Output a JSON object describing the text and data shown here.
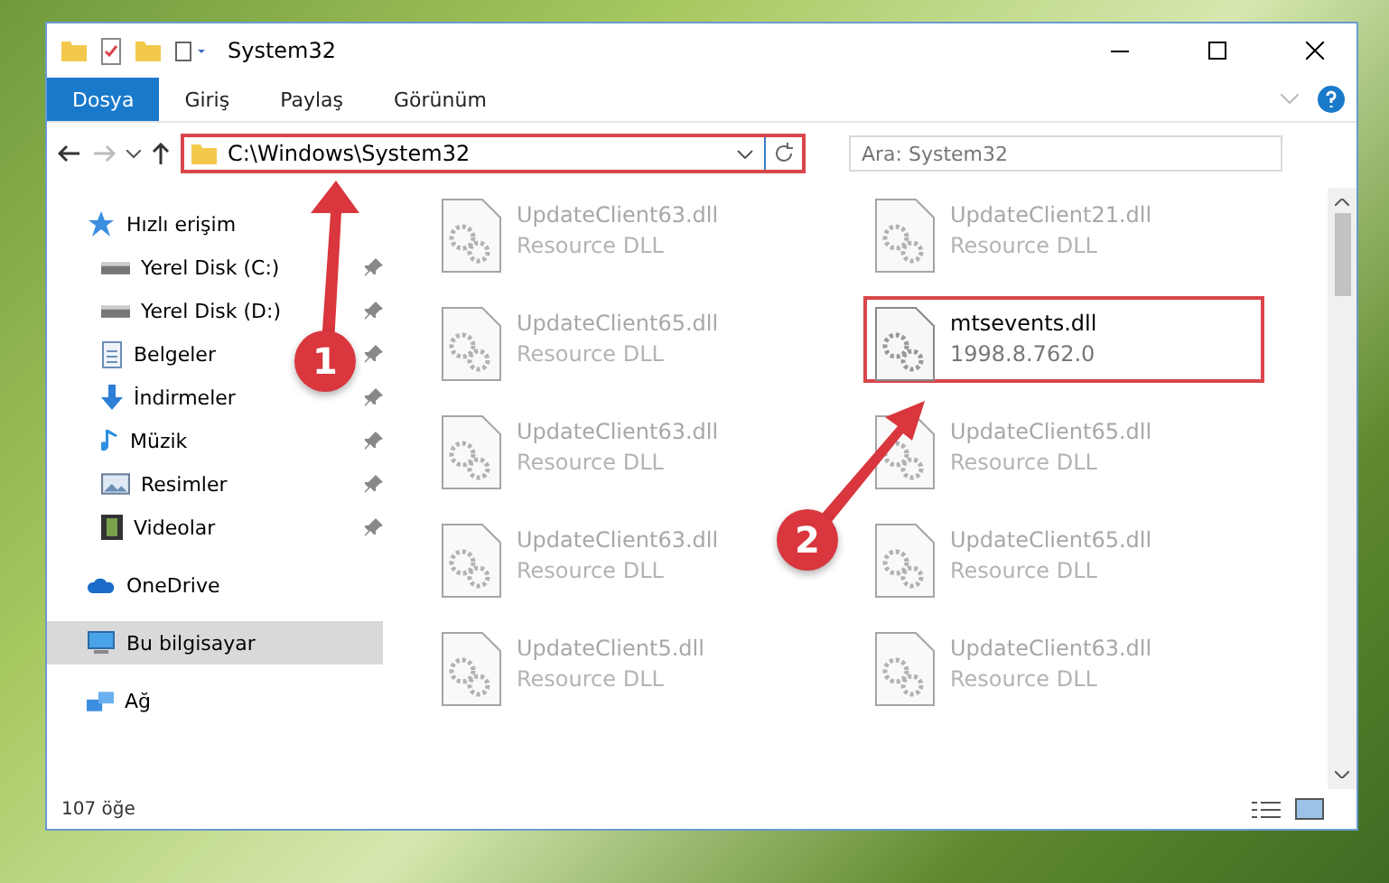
{
  "window": {
    "title": "System32"
  },
  "ribbon_tabs": [
    {
      "label": "Dosya",
      "selected": true
    },
    {
      "label": "Giriş",
      "selected": false
    },
    {
      "label": "Paylaş",
      "selected": false
    },
    {
      "label": "Görünüm",
      "selected": false
    }
  ],
  "address_bar": {
    "path": "C:\\Windows\\System32",
    "highlighted": true
  },
  "search": {
    "placeholder": "Ara: System32"
  },
  "sidebar": {
    "items": [
      {
        "label": "Hızlı erişim",
        "kind": "star",
        "selected": false,
        "children": [
          {
            "label": "Yerel Disk (C:)",
            "kind": "drive",
            "pinned": true
          },
          {
            "label": "Yerel Disk (D:)",
            "kind": "drive",
            "pinned": true
          },
          {
            "label": "Belgeler",
            "kind": "document",
            "pinned": true
          },
          {
            "label": "İndirmeler",
            "kind": "download",
            "pinned": true
          },
          {
            "label": "Müzik",
            "kind": "music",
            "pinned": true
          },
          {
            "label": "Resimler",
            "kind": "picture",
            "pinned": true
          },
          {
            "label": "Videolar",
            "kind": "video",
            "pinned": true
          }
        ]
      },
      {
        "label": "OneDrive",
        "kind": "cloud",
        "selected": false
      },
      {
        "label": "Bu bilgisayar",
        "kind": "computer",
        "selected": true
      },
      {
        "label": "Ağ",
        "kind": "network",
        "selected": false
      }
    ]
  },
  "files": [
    {
      "name": "UpdateClient63.dll",
      "subtitle": "Resource DLL",
      "faded": true,
      "highlighted": false
    },
    {
      "name": "UpdateClient21.dll",
      "subtitle": "Resource DLL",
      "faded": true,
      "highlighted": false
    },
    {
      "name": "UpdateClient65.dll",
      "subtitle": "Resource DLL",
      "faded": true,
      "highlighted": false
    },
    {
      "name": "mtsevents.dll",
      "subtitle": "1998.8.762.0",
      "faded": false,
      "highlighted": true
    },
    {
      "name": "UpdateClient63.dll",
      "subtitle": "Resource DLL",
      "faded": true,
      "highlighted": false
    },
    {
      "name": "UpdateClient65.dll",
      "subtitle": "Resource DLL",
      "faded": true,
      "highlighted": false
    },
    {
      "name": "UpdateClient63.dll",
      "subtitle": "Resource DLL",
      "faded": true,
      "highlighted": false
    },
    {
      "name": "UpdateClient65.dll",
      "subtitle": "Resource DLL",
      "faded": true,
      "highlighted": false
    },
    {
      "name": "UpdateClient5.dll",
      "subtitle": "Resource DLL",
      "faded": true,
      "highlighted": false
    },
    {
      "name": "UpdateClient63.dll",
      "subtitle": "Resource DLL",
      "faded": true,
      "highlighted": false
    }
  ],
  "status_bar": {
    "count": "107 öğe"
  },
  "annotations": [
    {
      "label": "1"
    },
    {
      "label": "2"
    }
  ]
}
